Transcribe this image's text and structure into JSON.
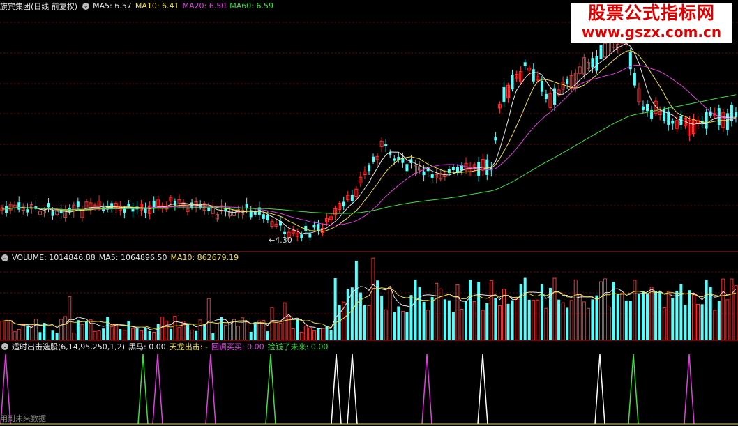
{
  "price_header": {
    "title": "旗宾集团(日线 前复权)",
    "items": [
      {
        "label": "MA5: 6.57",
        "color": "#e8e8e8"
      },
      {
        "label": "MA10: 6.41",
        "color": "#f0e040"
      },
      {
        "label": "MA20: 6.50",
        "color": "#e040e0"
      },
      {
        "label": "MA60: 6.59",
        "color": "#40e040"
      }
    ]
  },
  "volume_header": {
    "items": [
      {
        "label": "VOLUME: 1014846.88",
        "color": "#e8e8e8"
      },
      {
        "label": "MA5: 1064896.50",
        "color": "#e8e8e8"
      },
      {
        "label": "MA10: 862679.19",
        "color": "#f0e040"
      }
    ]
  },
  "indicator_header": {
    "items": [
      {
        "label": "适时出击选股(6,14,95,250,1,2)",
        "color": "#e8e8e8"
      },
      {
        "label": "黑马: 0.00",
        "color": "#e8e8e8"
      },
      {
        "label": "天龙出击: -",
        "color": "#f0e040"
      },
      {
        "label": "回调买买: 0.00",
        "color": "#e040e0"
      },
      {
        "label": "捡钱了未来: 0.00",
        "color": "#40e040"
      }
    ]
  },
  "watermark": {
    "line1": "股票公式指标网",
    "line2": "www.gszx.com.cn"
  },
  "low_label": "4.30",
  "footer_note": "用到未来数据",
  "colors": {
    "up": "#ff3030",
    "down": "#54ffff",
    "grid": "#7a0000",
    "ma5": "#e8e8e8",
    "ma10": "#f0e040",
    "ma20": "#e040e0",
    "ma60": "#40e040"
  }
}
